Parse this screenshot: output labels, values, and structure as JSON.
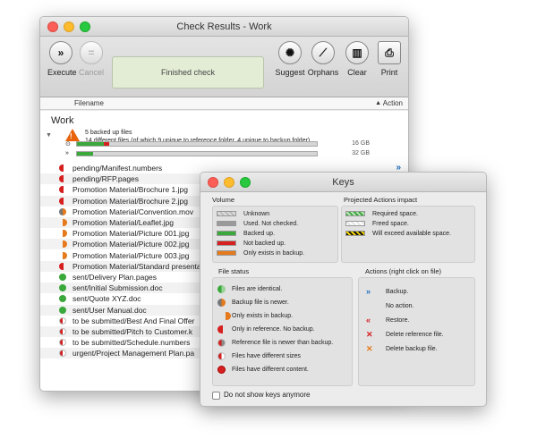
{
  "main_window": {
    "title": "Check Results - Work",
    "toolbar": {
      "execute": "Execute",
      "cancel": "Cancel",
      "status": "Finished check",
      "suggest": "Suggest",
      "orphans": "Orphans",
      "clear": "Clear",
      "print": "Print"
    },
    "columns": {
      "filename": "Filename",
      "action": "Action"
    },
    "group": {
      "title": "Work",
      "summary_line1": "5 backed up files",
      "summary_line2": "14 different files (of which 9 unique to reference folder, 4 unique to backup folder)",
      "bar1_size": "16 GB",
      "bar2_size": "32 GB"
    },
    "files": [
      {
        "name": "pending/Manifest.numbers",
        "status": "red",
        "action": "backup"
      },
      {
        "name": "pending/RFP.pages",
        "status": "red",
        "action": "backup"
      },
      {
        "name": "Promotion Material/Brochure 1.jpg",
        "status": "red",
        "action": ""
      },
      {
        "name": "Promotion Material/Brochure 2.jpg",
        "status": "red",
        "action": ""
      },
      {
        "name": "Promotion Material/Convention.mov",
        "status": "split-og",
        "action": ""
      },
      {
        "name": "Promotion Material/Leaflet.jpg",
        "status": "orange",
        "action": ""
      },
      {
        "name": "Promotion Material/Picture 001.jpg",
        "status": "orange",
        "action": ""
      },
      {
        "name": "Promotion Material/Picture 002.jpg",
        "status": "orange",
        "action": ""
      },
      {
        "name": "Promotion Material/Picture 003.jpg",
        "status": "orange",
        "action": ""
      },
      {
        "name": "Promotion Material/Standard presentation",
        "status": "red",
        "action": ""
      },
      {
        "name": "sent/Delivery Plan.pages",
        "status": "green",
        "action": ""
      },
      {
        "name": "sent/Initial Submission.doc",
        "status": "green",
        "action": ""
      },
      {
        "name": "sent/Quote XYZ.doc",
        "status": "green",
        "action": ""
      },
      {
        "name": "sent/User Manual.doc",
        "status": "green",
        "action": ""
      },
      {
        "name": "to be submitted/Best And Final Offer",
        "status": "split-rg",
        "action": ""
      },
      {
        "name": "to be submitted/Pitch to Customer.k",
        "status": "split-rg",
        "action": ""
      },
      {
        "name": "to be submitted/Schedule.numbers",
        "status": "split-rg",
        "action": ""
      },
      {
        "name": "urgent/Project Management Plan.pa",
        "status": "split-rg",
        "action": ""
      }
    ]
  },
  "keys_window": {
    "title": "Keys",
    "volume": {
      "title": "Volume",
      "items": [
        "Unknown",
        "Used. Not checked.",
        "Backed up.",
        "Not backed up.",
        "Only exists in backup."
      ]
    },
    "projected": {
      "title": "Projected Actions impact",
      "items": [
        "Required space.",
        "Freed space.",
        "Will exceed available space."
      ]
    },
    "file_status": {
      "title": "File status",
      "items": [
        "Files are identical.",
        "Backup file is newer.",
        "Only exists in backup.",
        "Only in reference. No backup.",
        "Reference file is newer than backup.",
        "Files have different sizes",
        "Files have different content."
      ]
    },
    "actions": {
      "title": "Actions (right click on file)",
      "items": [
        "Backup.",
        "No action.",
        "Restore.",
        "Delete reference file.",
        "Delete backup file."
      ]
    },
    "checkbox_label": "Do not show keys anymore"
  }
}
